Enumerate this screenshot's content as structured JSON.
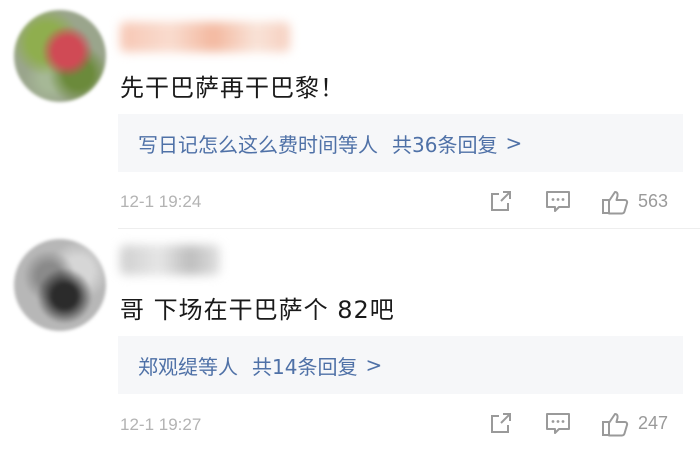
{
  "comments": [
    {
      "content": "先干巴萨再干巴黎！",
      "replies": {
        "names": "写日记怎么这么费时间等人",
        "count": "共36条回复",
        "chevron": ">"
      },
      "time": "12-1 19:24",
      "likes": "563"
    },
    {
      "content": "哥 下场在干巴萨个 82吧",
      "replies": {
        "names": "郑观缇等人",
        "count": "共14条回复",
        "chevron": ">"
      },
      "time": "12-1 19:27",
      "likes": "247"
    }
  ],
  "icons": {
    "share": "share-icon",
    "comment": "comment-icon",
    "like": "like-icon"
  },
  "colors": {
    "link": "#4f71a7",
    "meta": "#b3b3b3",
    "reply_bg": "#f6f7f9"
  }
}
